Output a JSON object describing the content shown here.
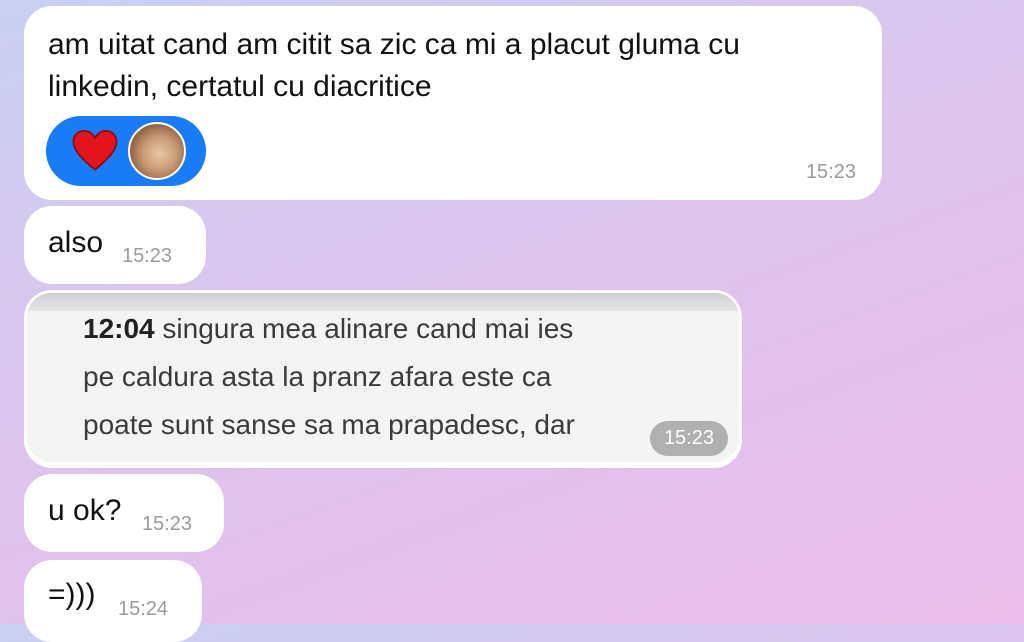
{
  "messages": [
    {
      "lines": [
        "am uitat cand am citit sa zic ca mi a placut gluma cu",
        "linkedin, certatul cu diacritice"
      ],
      "time": "15:23",
      "reactions": [
        {
          "icon": "heart-icon"
        },
        {
          "icon": "avatar"
        }
      ]
    },
    {
      "text": "also",
      "time": "15:23"
    },
    {
      "type": "image",
      "quoted_time": "12:04",
      "lines": [
        " singura mea alinare cand mai ies",
        "pe caldura asta la pranz afara este ca",
        "poate sunt sanse sa ma prapadesc, dar"
      ],
      "time": "15:23"
    },
    {
      "text": "u ok?",
      "time": "15:23"
    },
    {
      "text": "=)))",
      "time": "15:24"
    }
  ],
  "colors": {
    "bubble": "#ffffff",
    "reaction_pill": "#1a7cf5",
    "heart": "#e3141b",
    "timestamp": "#9a9aa0"
  }
}
